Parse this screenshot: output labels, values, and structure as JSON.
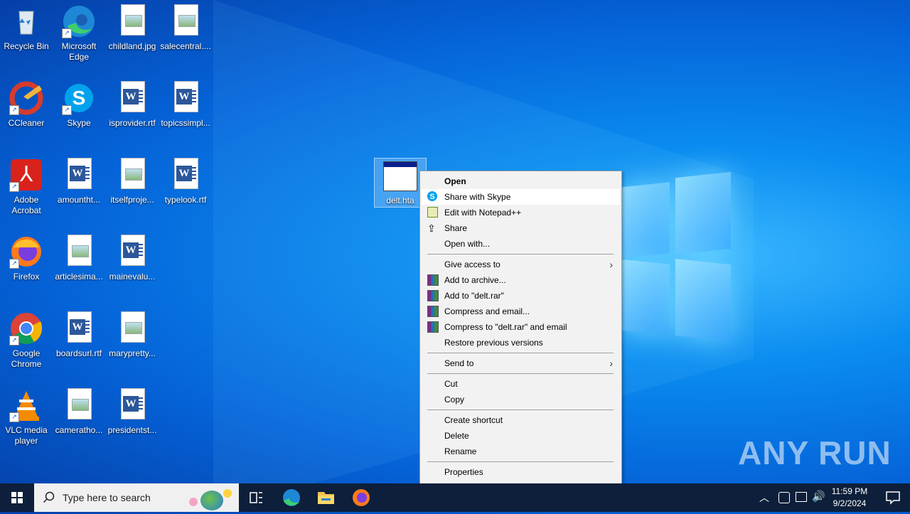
{
  "desktop": {
    "icons": [
      {
        "label": "Recycle Bin"
      },
      {
        "label": "Microsoft Edge"
      },
      {
        "label": "childland.jpg"
      },
      {
        "label": "salecentral...."
      },
      {
        "label": "CCleaner"
      },
      {
        "label": "Skype"
      },
      {
        "label": "isprovider.rtf"
      },
      {
        "label": "topicssimpl..."
      },
      {
        "label": "Adobe Acrobat"
      },
      {
        "label": "amountht..."
      },
      {
        "label": "itselfproje..."
      },
      {
        "label": "typelook.rtf"
      },
      {
        "label": "Firefox"
      },
      {
        "label": "articlesima..."
      },
      {
        "label": "mainevalu..."
      },
      {
        "label": "Google Chrome"
      },
      {
        "label": "boardsurl.rtf"
      },
      {
        "label": "marypretty..."
      },
      {
        "label": "VLC media player"
      },
      {
        "label": "cameratho..."
      },
      {
        "label": "presidentst..."
      }
    ],
    "selected_file": "delt.hta",
    "watermark": "ANY RUN"
  },
  "context_menu": {
    "items": [
      {
        "label": "Open"
      },
      {
        "label": "Share with Skype"
      },
      {
        "label": "Edit with Notepad++"
      },
      {
        "label": "Share"
      },
      {
        "label": "Open with..."
      },
      {
        "label": "Give access to"
      },
      {
        "label": "Add to archive..."
      },
      {
        "label": "Add to \"delt.rar\""
      },
      {
        "label": "Compress and email..."
      },
      {
        "label": "Compress to \"delt.rar\" and email"
      },
      {
        "label": "Restore previous versions"
      },
      {
        "label": "Send to"
      },
      {
        "label": "Cut"
      },
      {
        "label": "Copy"
      },
      {
        "label": "Create shortcut"
      },
      {
        "label": "Delete"
      },
      {
        "label": "Rename"
      },
      {
        "label": "Properties"
      }
    ]
  },
  "taskbar": {
    "search_placeholder": "Type here to search",
    "time": "11:59 PM",
    "date": "9/2/2024"
  },
  "colors": {
    "accent": "#0a8cf0",
    "taskbar": "#0d1f3a",
    "menu_bg": "#f2f2f2"
  }
}
